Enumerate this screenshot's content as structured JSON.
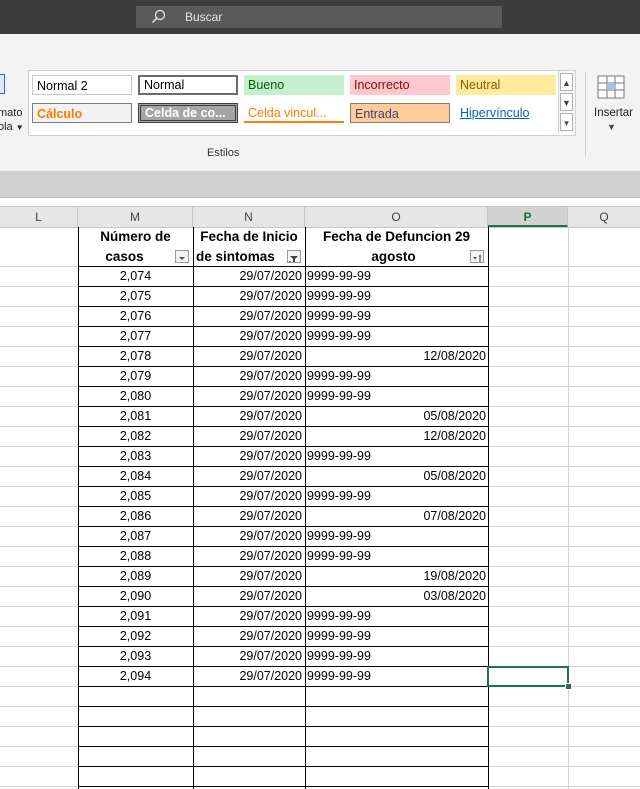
{
  "search": {
    "label": "Buscar"
  },
  "ribbon": {
    "left_fragment": [
      "mato",
      "ola"
    ],
    "styles_group_label": "Estilos",
    "insert_label": "Insertar"
  },
  "styles": [
    {
      "label": "Normal 2"
    },
    {
      "label": "Normal"
    },
    {
      "label": "Bueno"
    },
    {
      "label": "Incorrecto"
    },
    {
      "label": "Neutral"
    },
    {
      "label": "Cálculo"
    },
    {
      "label": "Celda de co..."
    },
    {
      "label": "Celda vincul..."
    },
    {
      "label": "Entrada"
    },
    {
      "label": "Hipervínculo"
    }
  ],
  "columns": [
    "L",
    "M",
    "N",
    "O",
    "P",
    "Q"
  ],
  "selected_column": "P",
  "table": {
    "headers": {
      "m": [
        "Número de",
        "casos"
      ],
      "n": [
        "Fecha de Inicio",
        "de sintomas"
      ],
      "o": [
        "Fecha de Defuncion 29",
        "agosto"
      ]
    },
    "rows": [
      {
        "casos": "2,074",
        "inicio": "29/07/2020",
        "defuncion": "9999-99-99"
      },
      {
        "casos": "2,075",
        "inicio": "29/07/2020",
        "defuncion": "9999-99-99"
      },
      {
        "casos": "2,076",
        "inicio": "29/07/2020",
        "defuncion": "9999-99-99"
      },
      {
        "casos": "2,077",
        "inicio": "29/07/2020",
        "defuncion": "9999-99-99"
      },
      {
        "casos": "2,078",
        "inicio": "29/07/2020",
        "defuncion": "12/08/2020"
      },
      {
        "casos": "2,079",
        "inicio": "29/07/2020",
        "defuncion": "9999-99-99"
      },
      {
        "casos": "2,080",
        "inicio": "29/07/2020",
        "defuncion": "9999-99-99"
      },
      {
        "casos": "2,081",
        "inicio": "29/07/2020",
        "defuncion": "05/08/2020"
      },
      {
        "casos": "2,082",
        "inicio": "29/07/2020",
        "defuncion": "12/08/2020"
      },
      {
        "casos": "2,083",
        "inicio": "29/07/2020",
        "defuncion": "9999-99-99"
      },
      {
        "casos": "2,084",
        "inicio": "29/07/2020",
        "defuncion": "05/08/2020"
      },
      {
        "casos": "2,085",
        "inicio": "29/07/2020",
        "defuncion": "9999-99-99"
      },
      {
        "casos": "2,086",
        "inicio": "29/07/2020",
        "defuncion": "07/08/2020"
      },
      {
        "casos": "2,087",
        "inicio": "29/07/2020",
        "defuncion": "9999-99-99"
      },
      {
        "casos": "2,088",
        "inicio": "29/07/2020",
        "defuncion": "9999-99-99"
      },
      {
        "casos": "2,089",
        "inicio": "29/07/2020",
        "defuncion": "19/08/2020"
      },
      {
        "casos": "2,090",
        "inicio": "29/07/2020",
        "defuncion": "03/08/2020"
      },
      {
        "casos": "2,091",
        "inicio": "29/07/2020",
        "defuncion": "9999-99-99"
      },
      {
        "casos": "2,092",
        "inicio": "29/07/2020",
        "defuncion": "9999-99-99"
      },
      {
        "casos": "2,093",
        "inicio": "29/07/2020",
        "defuncion": "9999-99-99"
      },
      {
        "casos": "2,094",
        "inicio": "29/07/2020",
        "defuncion": "9999-99-99"
      }
    ]
  }
}
